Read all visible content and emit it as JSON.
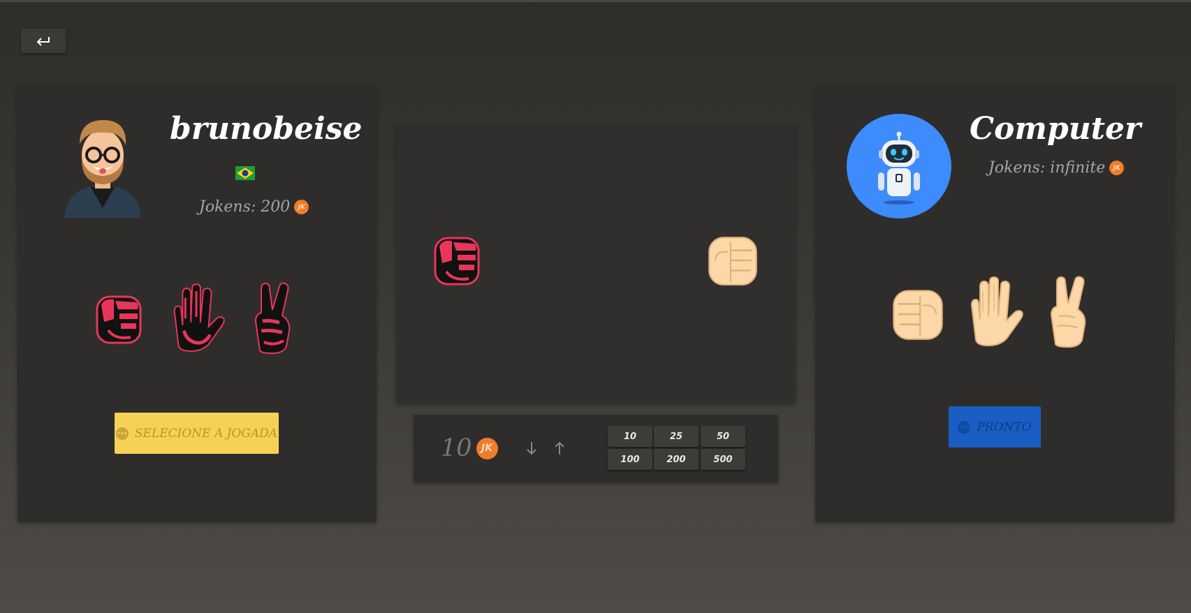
{
  "nav": {
    "back_icon": "return-arrow-icon"
  },
  "player": {
    "name": "brunobeise",
    "avatar_icon": "bearded-man-avatar",
    "flag_icon": "brazil-flag-icon",
    "jokens_label": "Jokens: 200",
    "coin_text": "JK",
    "hands": [
      "rock",
      "paper",
      "scissors"
    ],
    "action_label": "SELECIONE A JOGADA"
  },
  "computer": {
    "name": "Computer",
    "avatar_icon": "robot-avatar",
    "jokens_label": "Jokens: infinite",
    "coin_text": "JK",
    "hands": [
      "rock",
      "paper",
      "scissors"
    ],
    "action_label": "PRONTO"
  },
  "arena": {
    "player_hand": "rock",
    "computer_hand": "rock"
  },
  "bet": {
    "amount": "10",
    "coin_text": "JK",
    "chips": [
      "10",
      "25",
      "50",
      "100",
      "200",
      "500"
    ]
  },
  "colors": {
    "player_hand": "#e8365a",
    "computer_hand": "#fcd8a8",
    "select_button": "#f5d156",
    "ready_button": "#1a5ec4",
    "coin": "#ee7d2b",
    "robot_circle": "#3d8bfd"
  }
}
